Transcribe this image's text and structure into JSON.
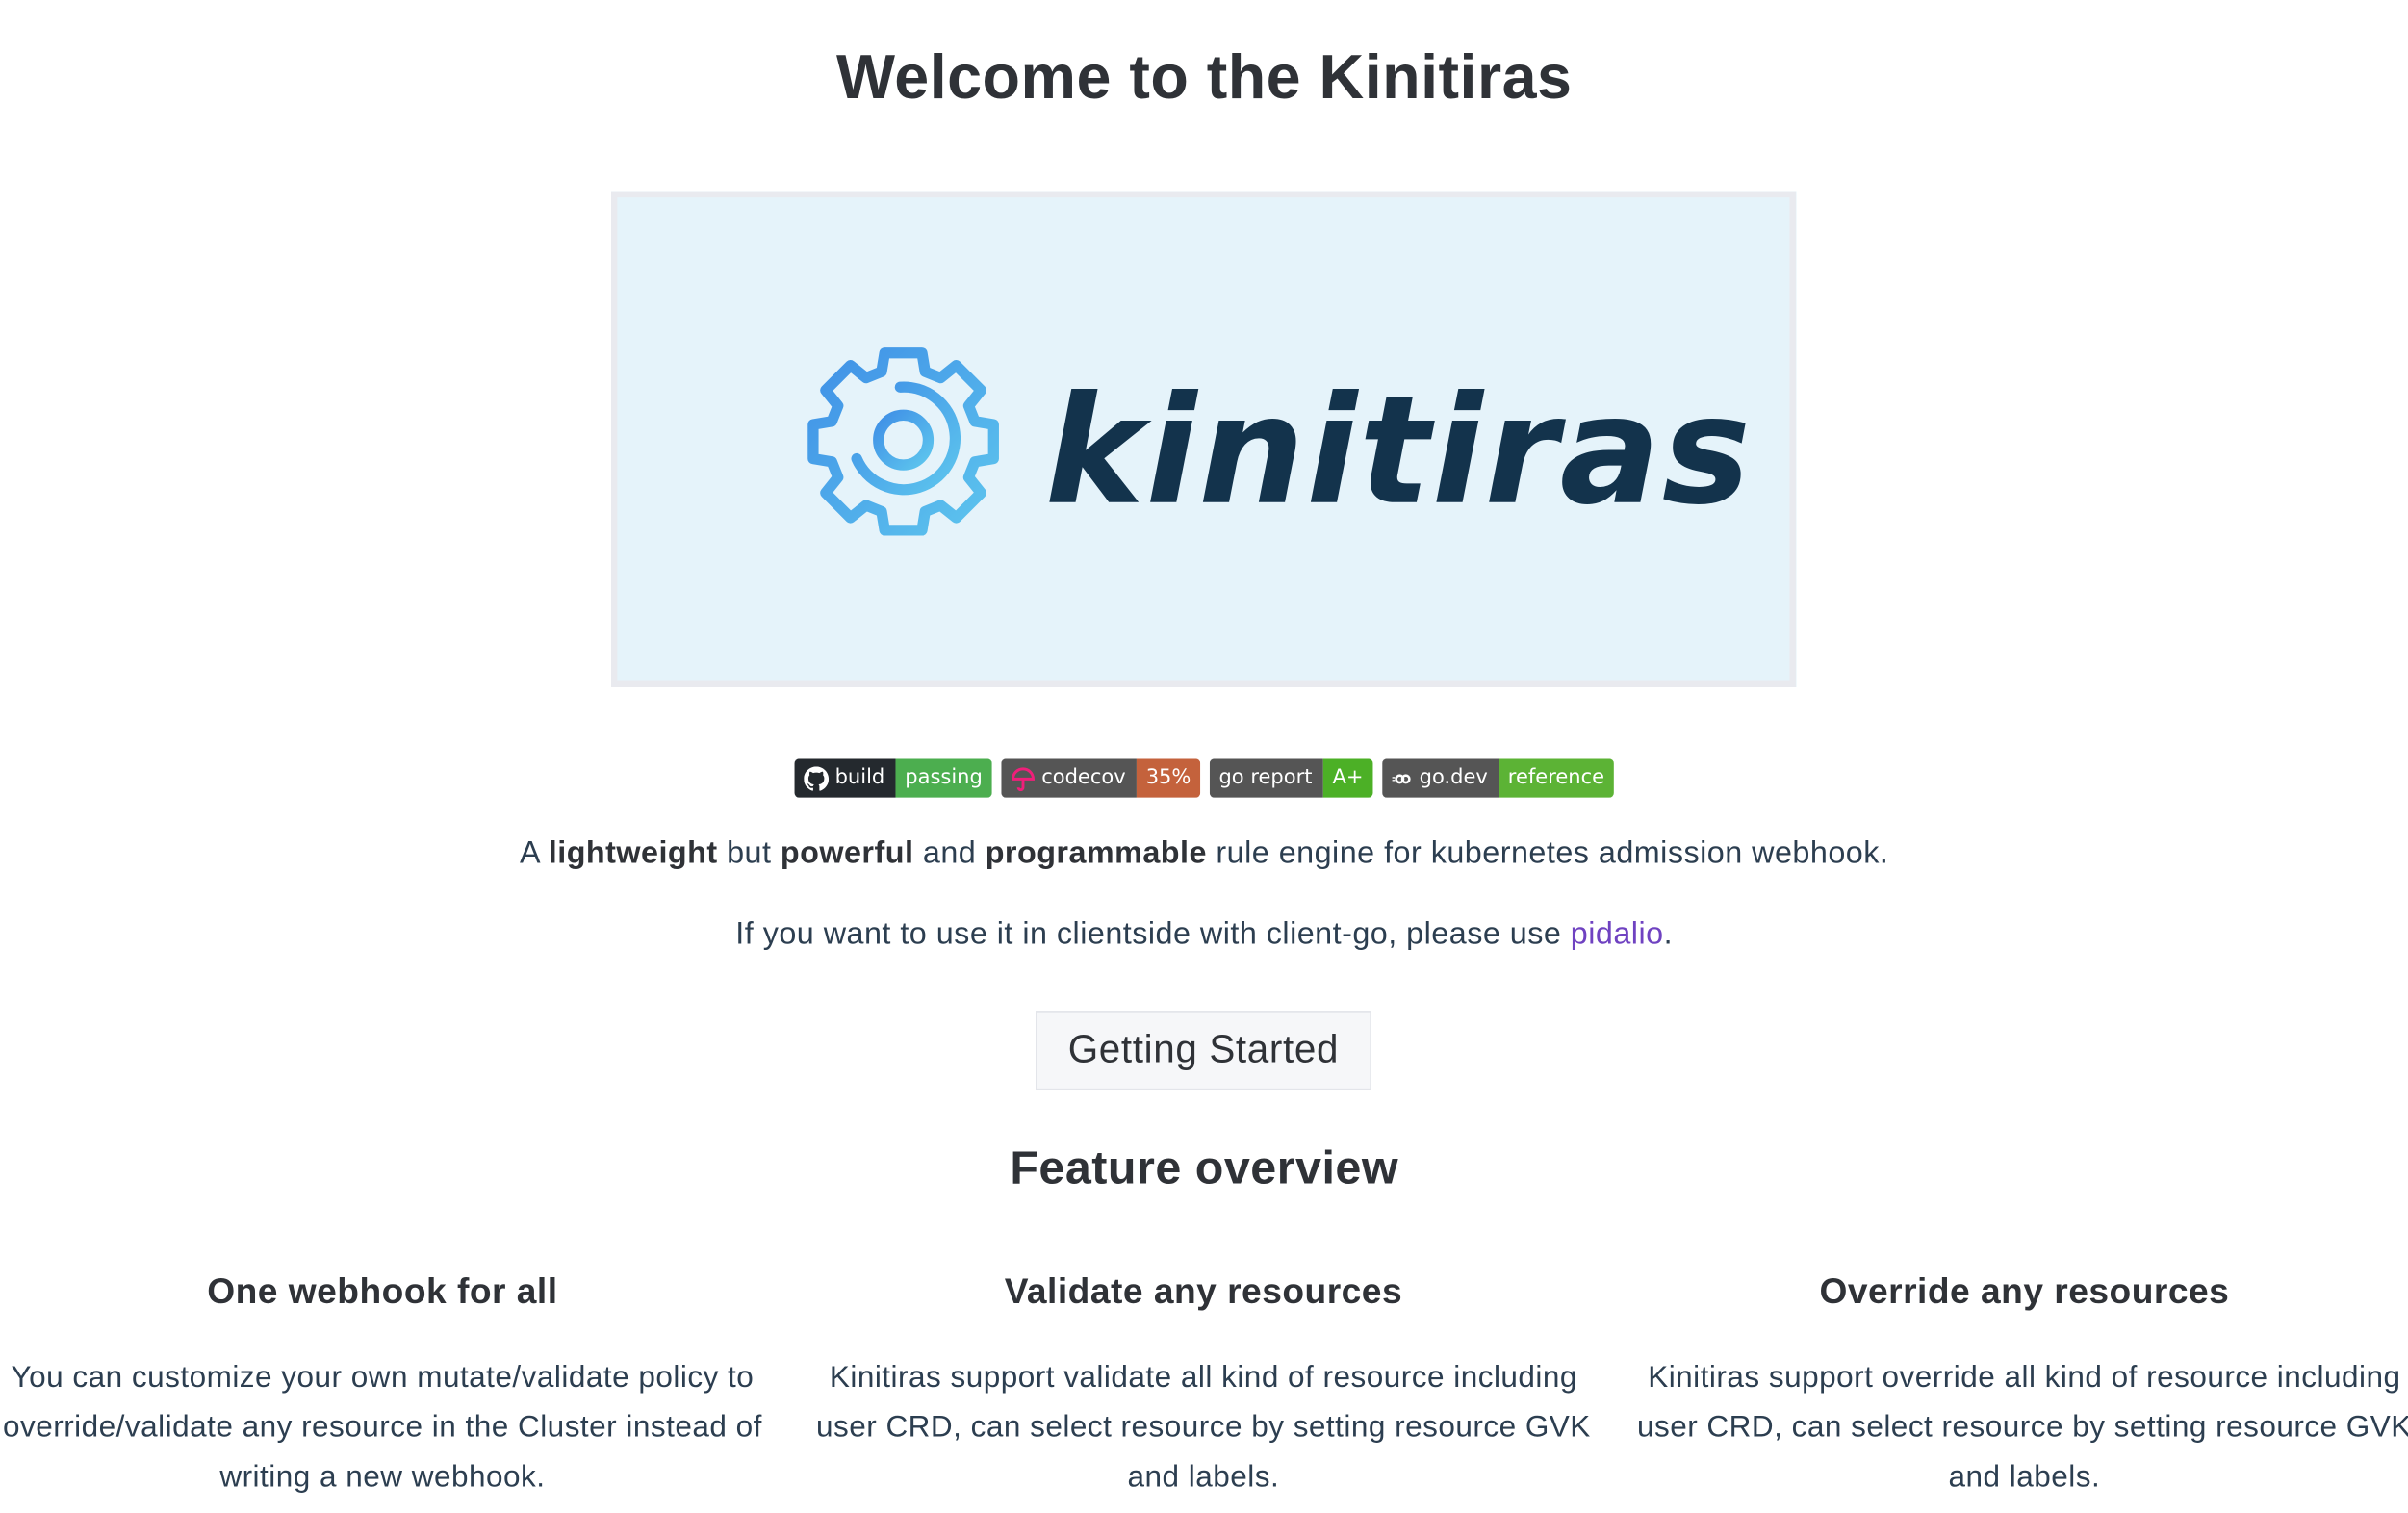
{
  "page": {
    "title": "Welcome to the Kinitiras"
  },
  "hero": {
    "logo_text": "kinitiras",
    "logo_icon": "gear-icon",
    "background_color": "#e5f3fa",
    "text_color": "#13334c"
  },
  "badges": [
    {
      "icon": "github-icon",
      "label": "build",
      "value": "passing",
      "value_color": "#4cae4f"
    },
    {
      "icon": "codecov-umbrella-icon",
      "label": "codecov",
      "value": "35%",
      "value_color": "#c4623c"
    },
    {
      "icon": "",
      "label": "go report",
      "value": "A+",
      "value_color": "#4cb026"
    },
    {
      "icon": "link-icon",
      "label": "go.dev",
      "value": "reference",
      "value_color": "#5cb335"
    }
  ],
  "tagline": {
    "prefix": "A ",
    "bold1": "lightweight",
    "mid1": " but ",
    "bold2": "powerful",
    "mid2": " and ",
    "bold3": "programmable",
    "suffix": " rule engine for kubernetes admission webhook."
  },
  "clientside": {
    "text": "If you want to use it in clientside with client-go, please use ",
    "link_text": "pidalio",
    "end": "."
  },
  "cta": {
    "label": "Getting Started"
  },
  "features_section": {
    "title": "Feature overview",
    "items": [
      {
        "title": "One webhook for all",
        "description": "You can customize your own mutate/validate policy to override/validate any resource in the Cluster instead of writing a new webhook."
      },
      {
        "title": "Validate any resources",
        "description": "Kinitiras support validate all kind of resource including user CRD, can select resource by setting resource GVK and labels."
      },
      {
        "title": "Override any resources",
        "description": "Kinitiras support override all kind of resource including user CRD, can select resource by setting resource GVK and labels."
      }
    ]
  },
  "colors": {
    "heading": "#2f3237",
    "body_text": "#2c3e50",
    "link": "#6f42c1"
  }
}
